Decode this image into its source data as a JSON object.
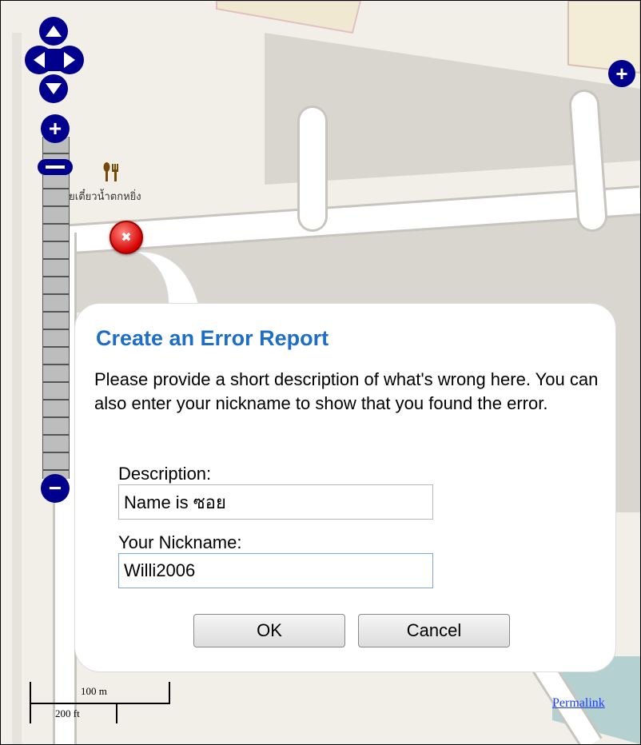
{
  "map": {
    "poi_label": "ก๋วยเตี๋ยวน้ำตกหยิ่ง",
    "poi_icon": "restaurant-icon",
    "marker_icon": "close-icon",
    "colors": {
      "background": "#f2efe9",
      "building": "#d9d6d0",
      "road": "#ffffff",
      "road_casing": "#c8c4be",
      "water": "#b5d0d0",
      "controls": "#00008c"
    }
  },
  "controls": {
    "pan_up_icon": "arrow-up-icon",
    "pan_down_icon": "arrow-down-icon",
    "pan_left_icon": "arrow-left-icon",
    "pan_right_icon": "arrow-right-icon",
    "zoom_in": "+",
    "zoom_out": "−",
    "layer_switcher": "+"
  },
  "popup": {
    "title": "Create an Error Report",
    "text": "Please provide a short description of what's wrong here. You can also enter your nickname to show that you found the error.",
    "description_label": "Description:",
    "description_value": "Name is ซอย",
    "nickname_label": "Your Nickname:",
    "nickname_value": "Willi2006",
    "ok_label": "OK",
    "cancel_label": "Cancel"
  },
  "scale": {
    "metric": "100 m",
    "imperial": "200 ft"
  },
  "permalink": "Permalink"
}
